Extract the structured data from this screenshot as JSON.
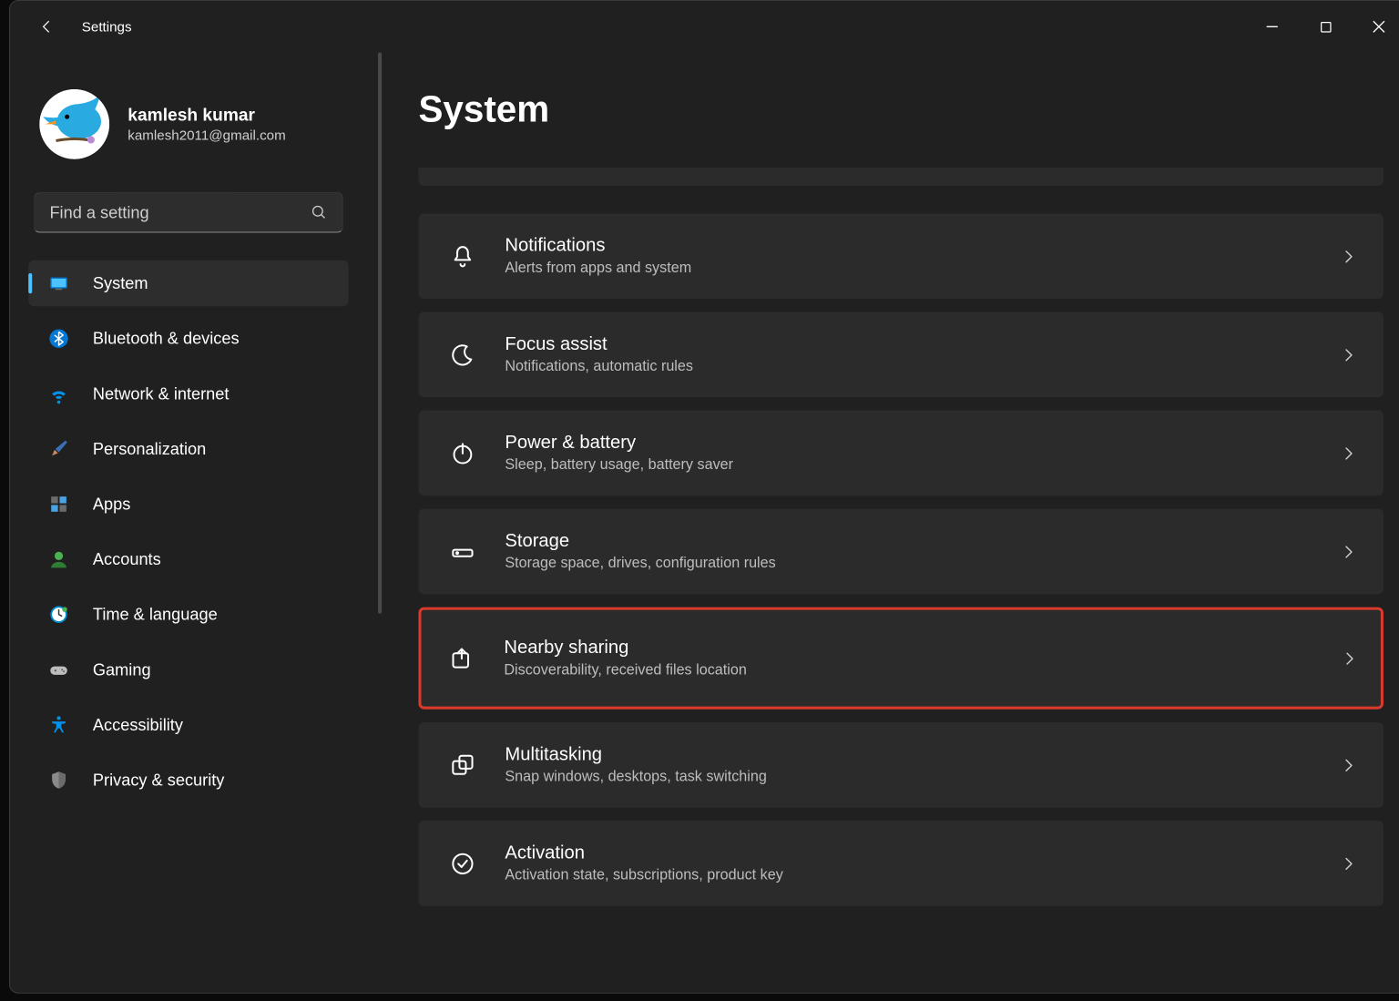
{
  "window": {
    "title": "Settings"
  },
  "user": {
    "name": "kamlesh kumar",
    "email": "kamlesh2011@gmail.com"
  },
  "search": {
    "placeholder": "Find a setting"
  },
  "page_title": "System",
  "sidebar": {
    "items": [
      {
        "label": "System",
        "icon": "monitor",
        "active": true
      },
      {
        "label": "Bluetooth & devices",
        "icon": "bluetooth",
        "active": false
      },
      {
        "label": "Network & internet",
        "icon": "wifi",
        "active": false
      },
      {
        "label": "Personalization",
        "icon": "brush",
        "active": false
      },
      {
        "label": "Apps",
        "icon": "apps",
        "active": false
      },
      {
        "label": "Accounts",
        "icon": "person",
        "active": false
      },
      {
        "label": "Time & language",
        "icon": "clock",
        "active": false
      },
      {
        "label": "Gaming",
        "icon": "gamepad",
        "active": false
      },
      {
        "label": "Accessibility",
        "icon": "access",
        "active": false
      },
      {
        "label": "Privacy & security",
        "icon": "shield",
        "active": false
      }
    ]
  },
  "cards": [
    {
      "title": "Notifications",
      "sub": "Alerts from apps and system",
      "icon": "bell",
      "highlight": false
    },
    {
      "title": "Focus assist",
      "sub": "Notifications, automatic rules",
      "icon": "moon",
      "highlight": false
    },
    {
      "title": "Power & battery",
      "sub": "Sleep, battery usage, battery saver",
      "icon": "power",
      "highlight": false
    },
    {
      "title": "Storage",
      "sub": "Storage space, drives, configuration rules",
      "icon": "storage",
      "highlight": false
    },
    {
      "title": "Nearby sharing",
      "sub": "Discoverability, received files location",
      "icon": "share",
      "highlight": true
    },
    {
      "title": "Multitasking",
      "sub": "Snap windows, desktops, task switching",
      "icon": "multi",
      "highlight": false
    },
    {
      "title": "Activation",
      "sub": "Activation state, subscriptions, product key",
      "icon": "check",
      "highlight": false
    }
  ]
}
